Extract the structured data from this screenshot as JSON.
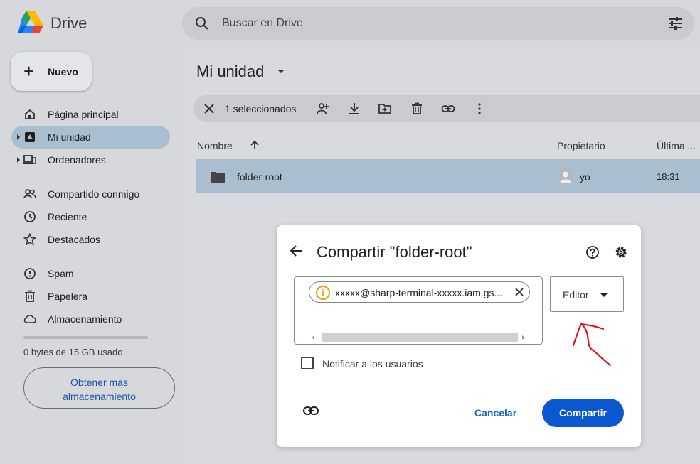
{
  "app": {
    "name": "Drive"
  },
  "search": {
    "placeholder": "Buscar en Drive"
  },
  "sidebar": {
    "new_label": "Nuevo",
    "items": [
      {
        "label": "Página principal",
        "icon": "home-icon"
      },
      {
        "label": "Mi unidad",
        "icon": "my-drive-icon",
        "active": true
      },
      {
        "label": "Ordenadores",
        "icon": "computers-icon"
      },
      {
        "label": "Compartido conmigo",
        "icon": "shared-icon"
      },
      {
        "label": "Reciente",
        "icon": "clock-icon"
      },
      {
        "label": "Destacados",
        "icon": "star-icon"
      },
      {
        "label": "Spam",
        "icon": "spam-icon"
      },
      {
        "label": "Papelera",
        "icon": "trash-icon"
      },
      {
        "label": "Almacenamiento",
        "icon": "cloud-icon"
      }
    ],
    "storage_text": "0 bytes de 15 GB usado",
    "get_storage_line1": "Obtener más",
    "get_storage_line2": "almacenamiento"
  },
  "main": {
    "title": "Mi unidad",
    "selection_count": "1 seleccionados",
    "columns": {
      "name": "Nombre",
      "owner": "Propietario",
      "modified": "Última ..."
    },
    "rows": [
      {
        "name": "folder-root",
        "owner": "yo",
        "modified": "18:31"
      }
    ]
  },
  "dialog": {
    "title": "Compartir \"folder-root\"",
    "chip_email": "xxxxx@sharp-terminal-xxxxx.iam.gs...",
    "role": "Editor",
    "notify_label": "Notificar a los usuarios",
    "cancel_label": "Cancelar",
    "share_label": "Compartir"
  },
  "colors": {
    "accent": "#0b57d0",
    "selection": "#a9bfd0",
    "annotation": "#e0181e",
    "warning": "#e3a20a"
  }
}
